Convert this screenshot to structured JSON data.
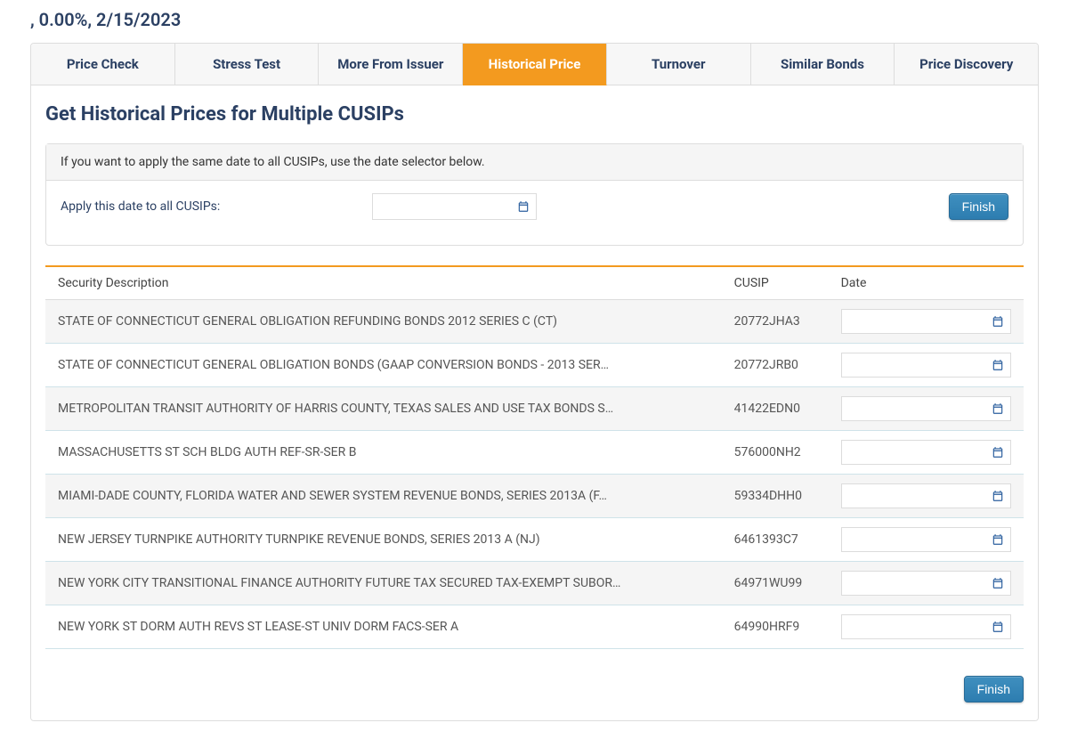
{
  "header": {
    "summary": ", 0.00%, 2/15/2023"
  },
  "tabs": [
    {
      "label": "Price Check",
      "active": false
    },
    {
      "label": "Stress Test",
      "active": false
    },
    {
      "label": "More From Issuer",
      "active": false
    },
    {
      "label": "Historical Price",
      "active": true
    },
    {
      "label": "Turnover",
      "active": false
    },
    {
      "label": "Similar Bonds",
      "active": false
    },
    {
      "label": "Price Discovery",
      "active": false
    }
  ],
  "section": {
    "title": "Get Historical Prices for Multiple CUSIPs",
    "panel_header": "If you want to apply the same date to all CUSIPs, use the date selector below.",
    "apply_label": "Apply this date to all CUSIPs:",
    "apply_date_value": "",
    "finish_label": "Finish"
  },
  "table": {
    "headers": {
      "description": "Security Description",
      "cusip": "CUSIP",
      "date": "Date"
    },
    "rows": [
      {
        "description": "STATE OF CONNECTICUT GENERAL OBLIGATION REFUNDING BONDS 2012 SERIES C (CT)",
        "cusip": "20772JHA3",
        "date": ""
      },
      {
        "description": "STATE OF CONNECTICUT GENERAL OBLIGATION BONDS (GAAP CONVERSION BONDS - 2013 SER…",
        "cusip": "20772JRB0",
        "date": ""
      },
      {
        "description": "METROPOLITAN TRANSIT AUTHORITY OF HARRIS COUNTY, TEXAS SALES AND USE TAX BONDS S…",
        "cusip": "41422EDN0",
        "date": ""
      },
      {
        "description": "MASSACHUSETTS ST SCH BLDG AUTH REF-SR-SER B",
        "cusip": "576000NH2",
        "date": ""
      },
      {
        "description": "MIAMI-DADE COUNTY, FLORIDA WATER AND SEWER SYSTEM REVENUE BONDS, SERIES 2013A (F…",
        "cusip": "59334DHH0",
        "date": ""
      },
      {
        "description": "NEW JERSEY TURNPIKE AUTHORITY TURNPIKE REVENUE BONDS, SERIES 2013 A (NJ)",
        "cusip": "6461393C7",
        "date": ""
      },
      {
        "description": "NEW YORK CITY TRANSITIONAL FINANCE AUTHORITY FUTURE TAX SECURED TAX-EXEMPT SUBOR…",
        "cusip": "64971WU99",
        "date": ""
      },
      {
        "description": "NEW YORK ST DORM AUTH REVS ST LEASE-ST UNIV DORM FACS-SER A",
        "cusip": "64990HRF9",
        "date": ""
      }
    ]
  }
}
